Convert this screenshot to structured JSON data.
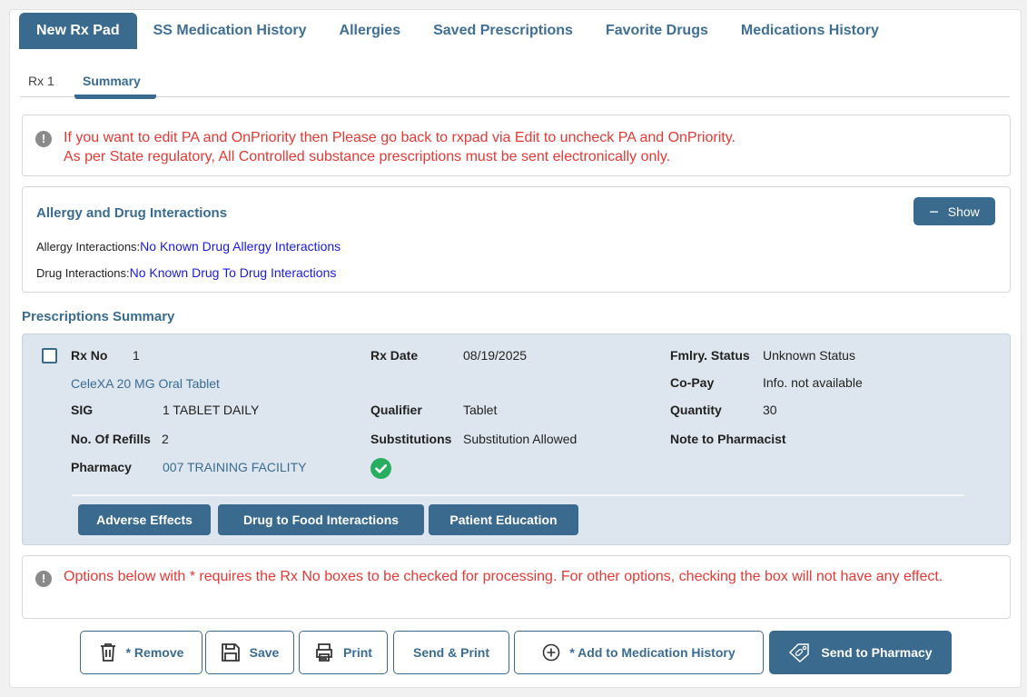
{
  "tabs": [
    {
      "label": "New Rx Pad",
      "active": true
    },
    {
      "label": "SS Medication History"
    },
    {
      "label": "Allergies"
    },
    {
      "label": "Saved Prescriptions"
    },
    {
      "label": "Favorite Drugs"
    },
    {
      "label": "Medications History"
    }
  ],
  "subtabs": {
    "rx1": "Rx 1",
    "summary": "Summary"
  },
  "alert_top": {
    "line1": "If you want to edit PA and OnPriority then Please go back to rxpad via Edit to uncheck PA and OnPriority.",
    "line2": "As per State regulatory, All Controlled substance prescriptions must be sent electronically only."
  },
  "interactions": {
    "title": "Allergy and Drug Interactions",
    "show_label": "Show",
    "allergy_label": "Allergy Interactions:",
    "allergy_value": "No Known Drug Allergy Interactions",
    "drug_label": "Drug Interactions:",
    "drug_value": "No Known Drug To Drug Interactions"
  },
  "summary_title": "Prescriptions Summary",
  "rx": {
    "rx_no_label": "Rx No",
    "rx_no": "1",
    "drug": "CeleXA 20 MG Oral Tablet",
    "sig_label": "SIG",
    "sig": "1 TABLET DAILY",
    "refills_label": "No. Of Refills",
    "refills": "2",
    "pharmacy_label": "Pharmacy",
    "pharmacy": "007 TRAINING FACILITY",
    "rx_date_label": "Rx Date",
    "rx_date": "08/19/2025",
    "qualifier_label": "Qualifier",
    "qualifier": "Tablet",
    "substitutions_label": "Substitutions",
    "substitutions": "Substitution Allowed",
    "fmlry_label": "Fmlry. Status",
    "fmlry": "Unknown Status",
    "copay_label": "Co-Pay",
    "copay": "Info. not available",
    "quantity_label": "Quantity",
    "quantity": "30",
    "note_label": "Note to Pharmacist",
    "buttons": {
      "adverse": "Adverse Effects",
      "food": "Drug to Food Interactions",
      "education": "Patient Education"
    }
  },
  "alert_bottom": {
    "text": "Options below with * requires the Rx No boxes to be checked for processing. For other options, checking the box will not have any effect."
  },
  "actions": {
    "remove": "* Remove",
    "save": "Save",
    "print": "Print",
    "send_print": "Send & Print",
    "add_history": "* Add to Medication History",
    "send_pharmacy": "Send to Pharmacy"
  },
  "colors": {
    "primary": "#3b6a8f",
    "alert_text": "#e53935",
    "link_blue": "#1a1ae6",
    "success": "#27ae60"
  }
}
